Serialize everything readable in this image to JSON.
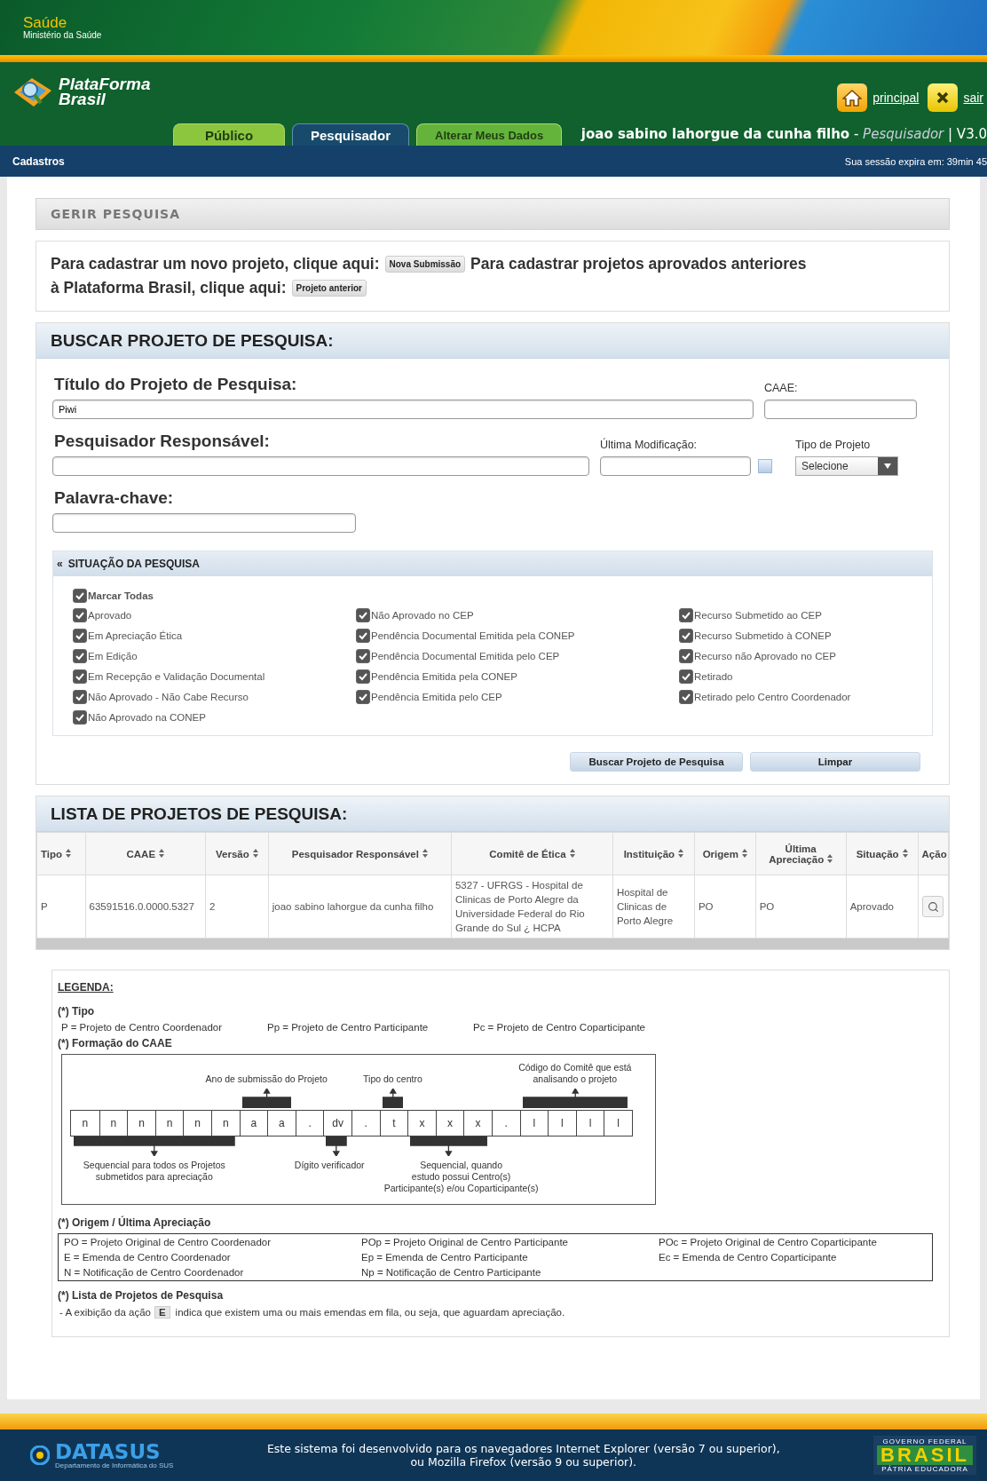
{
  "header": {
    "brand_title": "Saúde",
    "brand_subtitle": "Ministério da Saúde",
    "logo_line1": "PlataForma",
    "logo_line2": "Brasil",
    "links": [
      {
        "kind": "home",
        "label": "principal"
      },
      {
        "kind": "exit",
        "label": "sair"
      }
    ]
  },
  "tabs": [
    {
      "label": "Público",
      "selected": false
    },
    {
      "label": "Pesquisador",
      "selected": true
    },
    {
      "label": "Alterar Meus Dados",
      "selected": false
    }
  ],
  "user": "**joao sabino lahorgue da cunha filho** - *Pesquisador* | V3.0",
  "nav": {
    "menu": "Cadastros",
    "session": "Sua sessão expira em: 39min 45"
  },
  "page_title": "GERIR PESQUISA",
  "intro": [
    {
      "kind": "text",
      "text": "Para cadastrar um novo projeto, clique aqui:"
    },
    {
      "kind": "button",
      "text": "Nova Submissão"
    },
    {
      "kind": "text",
      "text": "Para cadastrar projetos aprovados anteriores"
    },
    {
      "kind": "text",
      "text": "à Plataforma Brasil, clique aqui:"
    },
    {
      "kind": "button",
      "text": "Projeto anterior"
    }
  ],
  "search": {
    "title": "BUSCAR PROJETO DE PESQUISA:",
    "titulo": {
      "label": "Título do Projeto de Pesquisa:",
      "value": "Piwi"
    },
    "caae": {
      "label": "CAAE:"
    },
    "pesquisador": {
      "label": "Pesquisador Responsável:"
    },
    "modificacao": {
      "label": "Última Modificação:"
    },
    "tipo": {
      "label": "Tipo de Projeto",
      "value": "Selecione"
    },
    "palavra": {
      "label": "Palavra-chave:"
    }
  },
  "status": {
    "toggle": "«",
    "title": "SITUAÇÃO DA PESQUISA",
    "select_all": {
      "label": "Marcar Todas",
      "checked": true
    },
    "columns": [
      [
        {
          "label": "Aprovado",
          "checked": true
        },
        {
          "label": "Em Apreciação Ética",
          "checked": true
        },
        {
          "label": "Em Edição",
          "checked": true
        },
        {
          "label": "Em Recepção e Validação Documental",
          "checked": true
        },
        {
          "label": "Não Aprovado - Não Cabe Recurso",
          "checked": true
        },
        {
          "label": "Não Aprovado na CONEP",
          "checked": true
        }
      ],
      [
        {
          "label": "Não Aprovado no CEP",
          "checked": true
        },
        {
          "label": "Pendência Documental Emitida pela CONEP",
          "checked": true
        },
        {
          "label": "Pendência Documental Emitida pelo CEP",
          "checked": true
        },
        {
          "label": "Pendência Emitida pela CONEP",
          "checked": true
        },
        {
          "label": "Pendência Emitida pelo CEP",
          "checked": true
        }
      ],
      [
        {
          "label": "Recurso Submetido ao CEP",
          "checked": true
        },
        {
          "label": "Recurso Submetido à CONEP",
          "checked": true
        },
        {
          "label": "Recurso não Aprovado no CEP",
          "checked": true
        },
        {
          "label": "Retirado",
          "checked": true
        },
        {
          "label": "Retirado pelo Centro Coordenador",
          "checked": true
        }
      ]
    ]
  },
  "actions": [
    "Buscar Projeto de Pesquisa",
    "Limpar"
  ],
  "results": {
    "title": "LISTA DE PROJETOS DE PESQUISA:",
    "columns": [
      {
        "label": "Tipo",
        "sortable": true
      },
      {
        "label": "CAAE",
        "sortable": true
      },
      {
        "label": "Versão",
        "sortable": true
      },
      {
        "label": "Pesquisador Responsável",
        "sortable": true
      },
      {
        "label": "Comitê de Ética",
        "sortable": true
      },
      {
        "label": "Instituição",
        "sortable": true
      },
      {
        "label": "Origem",
        "sortable": true
      },
      {
        "label": "Última Apreciação",
        "sortable": true
      },
      {
        "label": "Situação",
        "sortable": true
      },
      {
        "label": "Ação",
        "sortable": false
      }
    ],
    "rows": [
      {
        "cells": [
          "P",
          "63591516.0.0000.5327",
          "2",
          "joao sabino lahorgue da cunha filho",
          "5327 - UFRGS - Hospital de Clinicas de Porto Alegre da Universidade Federal do Rio Grande do Sul ¿ HCPA",
          "Hospital de Clinicas de Porto Alegre",
          "PO",
          "PO",
          "Aprovado"
        ]
      }
    ]
  },
  "legend": {
    "title": "LEGENDA:",
    "tipo": {
      "heading": "(*) Tipo",
      "items": [
        "P =  Projeto de Centro Coordenador",
        "Pp = Projeto de Centro Participante",
        "Pc = Projeto de Centro Coparticipante"
      ]
    },
    "caae": {
      "heading": "(*) Formação do CAAE",
      "cells": [
        "n",
        "n",
        "n",
        "n",
        "n",
        "n",
        "a",
        "a",
        ".",
        "dv",
        ".",
        "t",
        "x",
        "x",
        "x",
        ".",
        "l",
        "l",
        "l",
        "l"
      ],
      "annotations": [
        {
          "lines": [
            "Sequencial para todos os Projetos",
            "submetidos para apreciação"
          ]
        },
        {
          "lines": [
            "Ano de submissão do Projeto"
          ]
        },
        {
          "lines": [
            "Dígito verificador"
          ]
        },
        {
          "lines": [
            "Tipo do centro"
          ]
        },
        {
          "lines": [
            "Sequencial, quando",
            "estudo possui Centro(s)",
            "Participante(s) e/ou Coparticipante(s)"
          ]
        },
        {
          "lines": [
            "Código do Comitê que está",
            "analisando o projeto"
          ]
        }
      ]
    },
    "origem": {
      "heading": "(*) Origem / Última Apreciação",
      "columns": [
        [
          "PO = Projeto Original de Centro Coordenador",
          "E =  Emenda de Centro Coordenador",
          "N = Notificação de Centro Coordenador"
        ],
        [
          "POp = Projeto Original de Centro Participante",
          "Ep = Emenda de Centro Participante",
          "Np = Notificação de Centro Participante"
        ],
        [
          "POc = Projeto Original de Centro Coparticipante",
          "Ec = Emenda de Centro Coparticipante"
        ]
      ]
    },
    "lista": {
      "heading": "(*) Lista de Projetos de Pesquisa",
      "before": "- A exibição da ação",
      "badge": "E",
      "after": "indica que existem uma ou mais emendas em fila, ou seja, que aguardam apreciação."
    }
  },
  "footer": {
    "logo": "DATASUS",
    "logo_sub": "Departamento de Informática do SUS",
    "lines": [
      "Este sistema foi desenvolvido para os navegadores Internet Explorer (versão 7 ou superior),",
      "ou Mozilla Firefox (versão 9 ou superior)."
    ],
    "gov_top": "GOVERNO FEDERAL",
    "gov_main": "BRASIL",
    "gov_bottom": "PÁTRIA EDUCADORA"
  }
}
